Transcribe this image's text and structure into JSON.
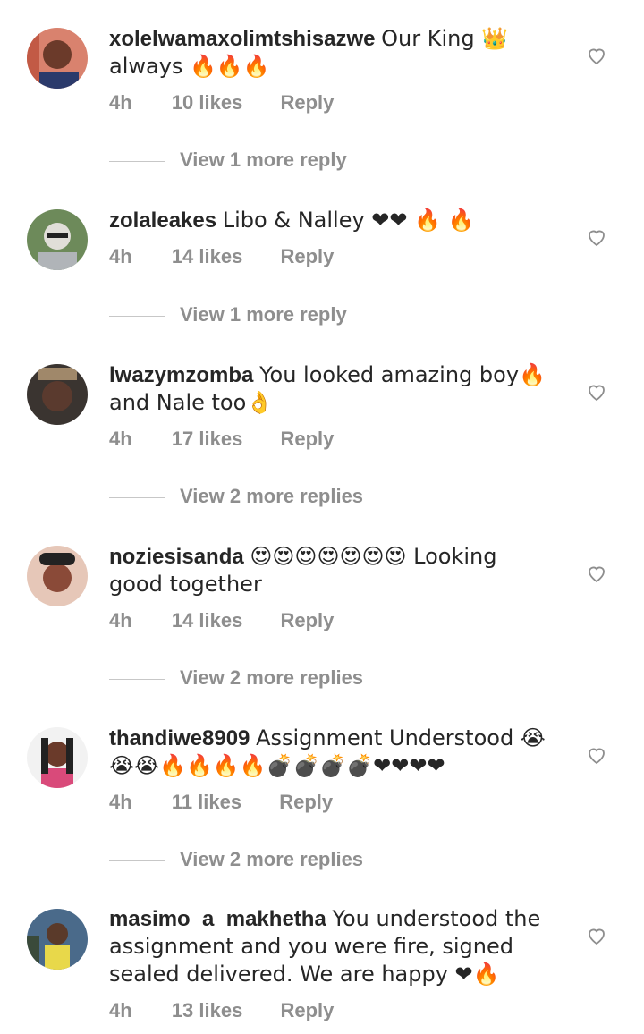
{
  "comments": [
    {
      "username": "xolelwamaxolimtshisazwe",
      "text": "Our King 👑 always 🔥🔥🔥",
      "time": "4h",
      "likes": "10 likes",
      "reply": "Reply",
      "view_replies": "View 1 more reply"
    },
    {
      "username": "zolaleakes",
      "text": "Libo & Nalley ❤❤ 🔥 🔥",
      "time": "4h",
      "likes": "14 likes",
      "reply": "Reply",
      "view_replies": "View 1 more reply"
    },
    {
      "username": "lwazymzomba",
      "text": "You looked amazing boy🔥 and Nale too👌",
      "time": "4h",
      "likes": "17 likes",
      "reply": "Reply",
      "view_replies": "View 2 more replies"
    },
    {
      "username": "noziesisanda",
      "text": "😍😍😍😍😍😍😍 Looking good together",
      "time": "4h",
      "likes": "14 likes",
      "reply": "Reply",
      "view_replies": "View 2 more replies"
    },
    {
      "username": "thandiwe8909",
      "text": "Assignment Understood 😭😭😭🔥🔥🔥🔥💣💣💣💣❤❤❤❤",
      "time": "4h",
      "likes": "11 likes",
      "reply": "Reply",
      "view_replies": "View 2 more replies"
    },
    {
      "username": "masimo_a_makhetha",
      "text": "You understood the assignment and you were fire, signed sealed delivered. We are happy ❤🔥",
      "time": "4h",
      "likes": "13 likes",
      "reply": "Reply",
      "view_replies": ""
    }
  ],
  "icons": {
    "like": "heart-outline-icon"
  },
  "colors": {
    "text": "#262626",
    "secondary": "#8e8e8e",
    "divider": "#c7c7c7"
  }
}
